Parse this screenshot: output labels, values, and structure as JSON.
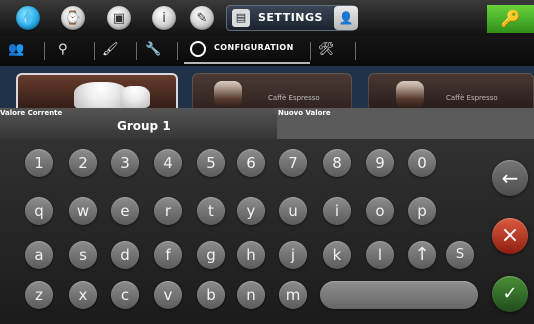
{
  "top_bar": {
    "settings_label": "SETTINGS",
    "icons": [
      "water-drop-icon",
      "clock-icon",
      "book-icon",
      "info-icon",
      "pencil-icon",
      "settings-icon",
      "user-icon",
      "key-icon"
    ]
  },
  "second_bar": {
    "configuration_label": "CONFIGURATION",
    "icons": [
      "people-icon",
      "filter-icon",
      "brush-icon",
      "wrench-icon",
      "gear-icon",
      "tool-user-icon"
    ]
  },
  "drink_tiles": [
    {
      "label": ""
    },
    {
      "label": "Caffè Espresso"
    },
    {
      "label": "Caffè Espresso"
    }
  ],
  "value_bar": {
    "current_label": "Valore Corrente",
    "current_value": "Group 1",
    "new_label": "Nuovo Valore"
  },
  "keyboard": {
    "row1": [
      "1",
      "2",
      "3",
      "4",
      "5",
      "6",
      "7",
      "8",
      "9",
      "0"
    ],
    "row2": [
      "q",
      "w",
      "e",
      "r",
      "t",
      "y",
      "u",
      "i",
      "o",
      "p"
    ],
    "row3": [
      "a",
      "s",
      "d",
      "f",
      "g",
      "h",
      "j",
      "k",
      "l",
      "↑",
      "S"
    ],
    "row4": [
      "z",
      "x",
      "c",
      "v",
      "b",
      "n",
      "m"
    ]
  },
  "actions": {
    "backspace_symbol": "←",
    "cancel_symbol": "×",
    "confirm_symbol": "✓"
  },
  "colors": {
    "settings_tab": "#2b3441",
    "key_button": "#45b02b",
    "cancel_button": "#c5472f",
    "confirm_button": "#3f7f32"
  }
}
